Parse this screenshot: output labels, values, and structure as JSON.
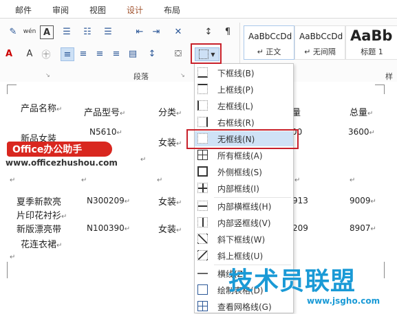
{
  "tabs": [
    "邮件",
    "审阅",
    "视图",
    "设计",
    "布局"
  ],
  "ribbon": {
    "group_label": "段落",
    "styles": [
      {
        "sample": "AaBbCcDd",
        "name": "↵ 正文"
      },
      {
        "sample": "AaBbCcDd",
        "name": "↵ 无间隔"
      },
      {
        "sample": "AaBb",
        "name": "标题 1"
      }
    ],
    "cut_label": "样式"
  },
  "table": {
    "headers": [
      "产品名称",
      "产品型号",
      "分类",
      "量",
      "总量"
    ],
    "rows": [
      {
        "name": "新品女装",
        "model": "N5610",
        "category": "女装",
        "qty": "00",
        "total": "3600"
      },
      {
        "name": "夏季新款亮",
        "name2": "片印花衬衫",
        "model": "N300209",
        "category": "女装",
        "qty": "913",
        "total": "9009"
      },
      {
        "name": "新版漂亮带",
        "name2": "花连衣裙",
        "model": "N100390",
        "category": "女装",
        "qty": "209",
        "total": "8907"
      }
    ]
  },
  "menu": {
    "items": [
      "下框线(B)",
      "上框线(P)",
      "左框线(L)",
      "右框线(R)",
      "无框线(N)",
      "所有框线(A)",
      "外侧框线(S)",
      "内部框线(I)",
      "内部横框线(H)",
      "内部竖框线(V)",
      "斜下框线(W)",
      "斜上框线(U)",
      "横线(Z)",
      "绘制表格(D)",
      "查看网格线(G)"
    ],
    "highlighted": "无框线(N)"
  },
  "watermark": {
    "badge": "Office办公助手",
    "url": "www.officezhushou.com",
    "brand": "技术员联盟",
    "brand_url": "www.jsgho.com"
  },
  "colors": {
    "accent": "#c8202a",
    "highlight": "#cfe2f6",
    "brand_blue": "#1a9ad6"
  }
}
